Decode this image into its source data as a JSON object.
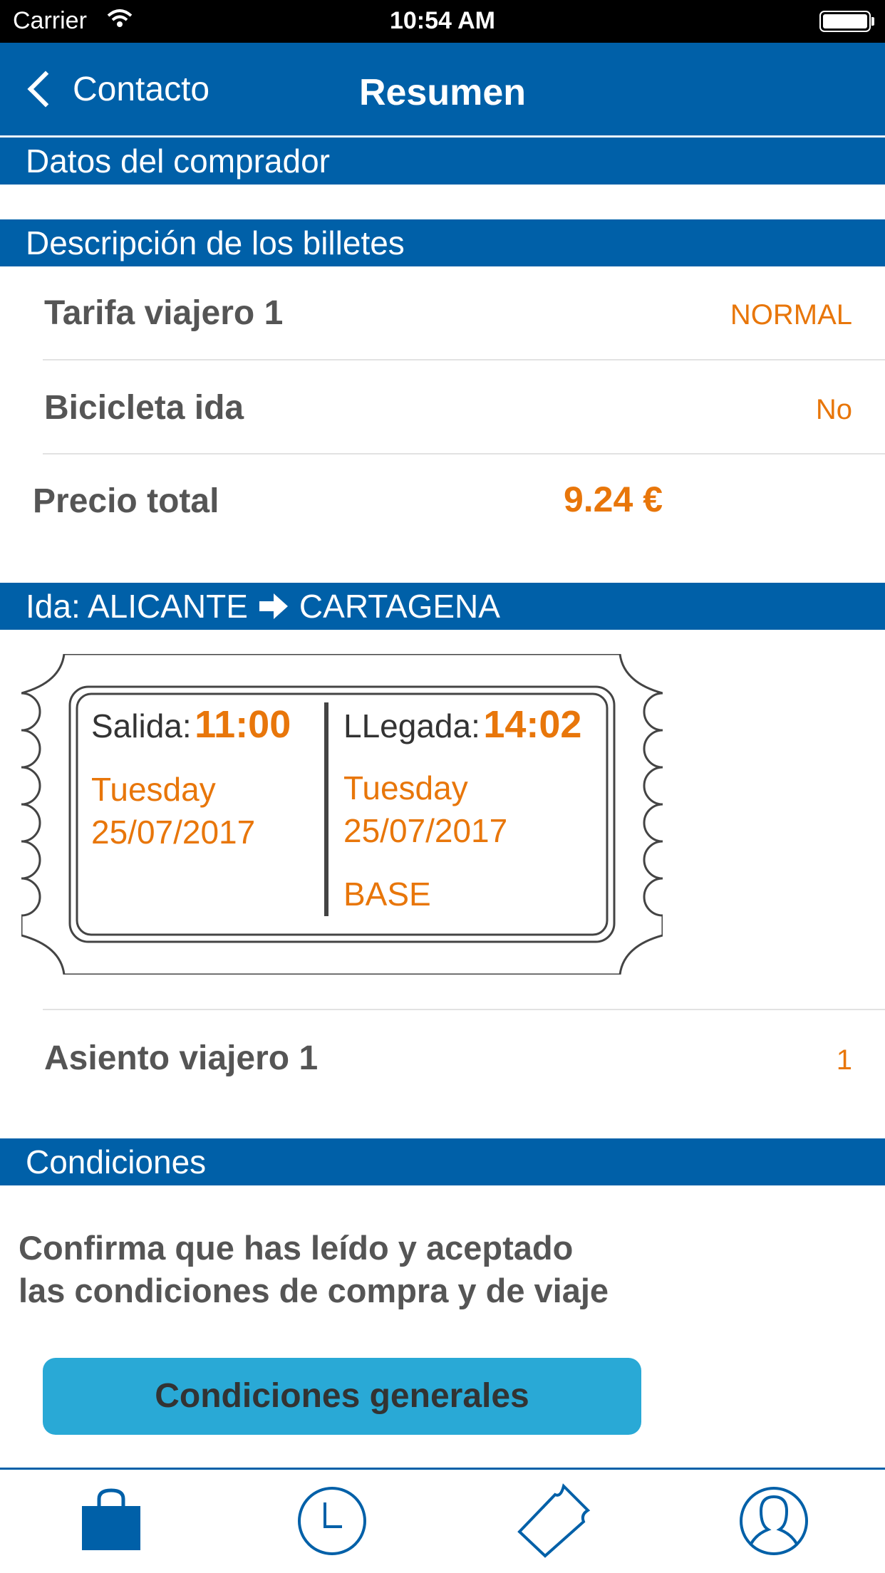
{
  "status_bar": {
    "carrier": "Carrier",
    "time": "10:54 AM"
  },
  "nav": {
    "back_label": "Contacto",
    "title": "Resumen"
  },
  "sections": {
    "buyer": "Datos del comprador",
    "tickets": "Descripción de los billetes",
    "trip_prefix": "Ida: ALICANTE",
    "trip_dest": "CARTAGENA",
    "conditions": "Condiciones"
  },
  "ticket_rows": [
    {
      "label": "Tarifa viajero 1",
      "value": "NORMAL"
    },
    {
      "label": "Bicicleta ida",
      "value": "No"
    }
  ],
  "total": {
    "label": "Precio total",
    "value": "9.24 €"
  },
  "ticket": {
    "departure_label": "Salida:",
    "departure_time": "11:00",
    "departure_day": "Tuesday",
    "departure_date": "25/07/2017",
    "arrival_label": "LLegada:",
    "arrival_time": "14:02",
    "arrival_day": "Tuesday",
    "arrival_date": "25/07/2017",
    "class": "BASE"
  },
  "seat": {
    "label": "Asiento viajero 1",
    "value": "1"
  },
  "conditions": {
    "line1": "Confirma que has leído y aceptado",
    "line2": "las condiciones de compra y de viaje",
    "button": "Condiciones generales"
  },
  "tabs": [
    {
      "icon": "shopping-bag-icon",
      "active": true
    },
    {
      "icon": "clock-icon",
      "active": false
    },
    {
      "icon": "ticket-icon",
      "active": false
    },
    {
      "icon": "user-icon",
      "active": false
    }
  ],
  "colors": {
    "primary": "#0060a8",
    "accent": "#e8760a",
    "button": "#29a9d6"
  }
}
